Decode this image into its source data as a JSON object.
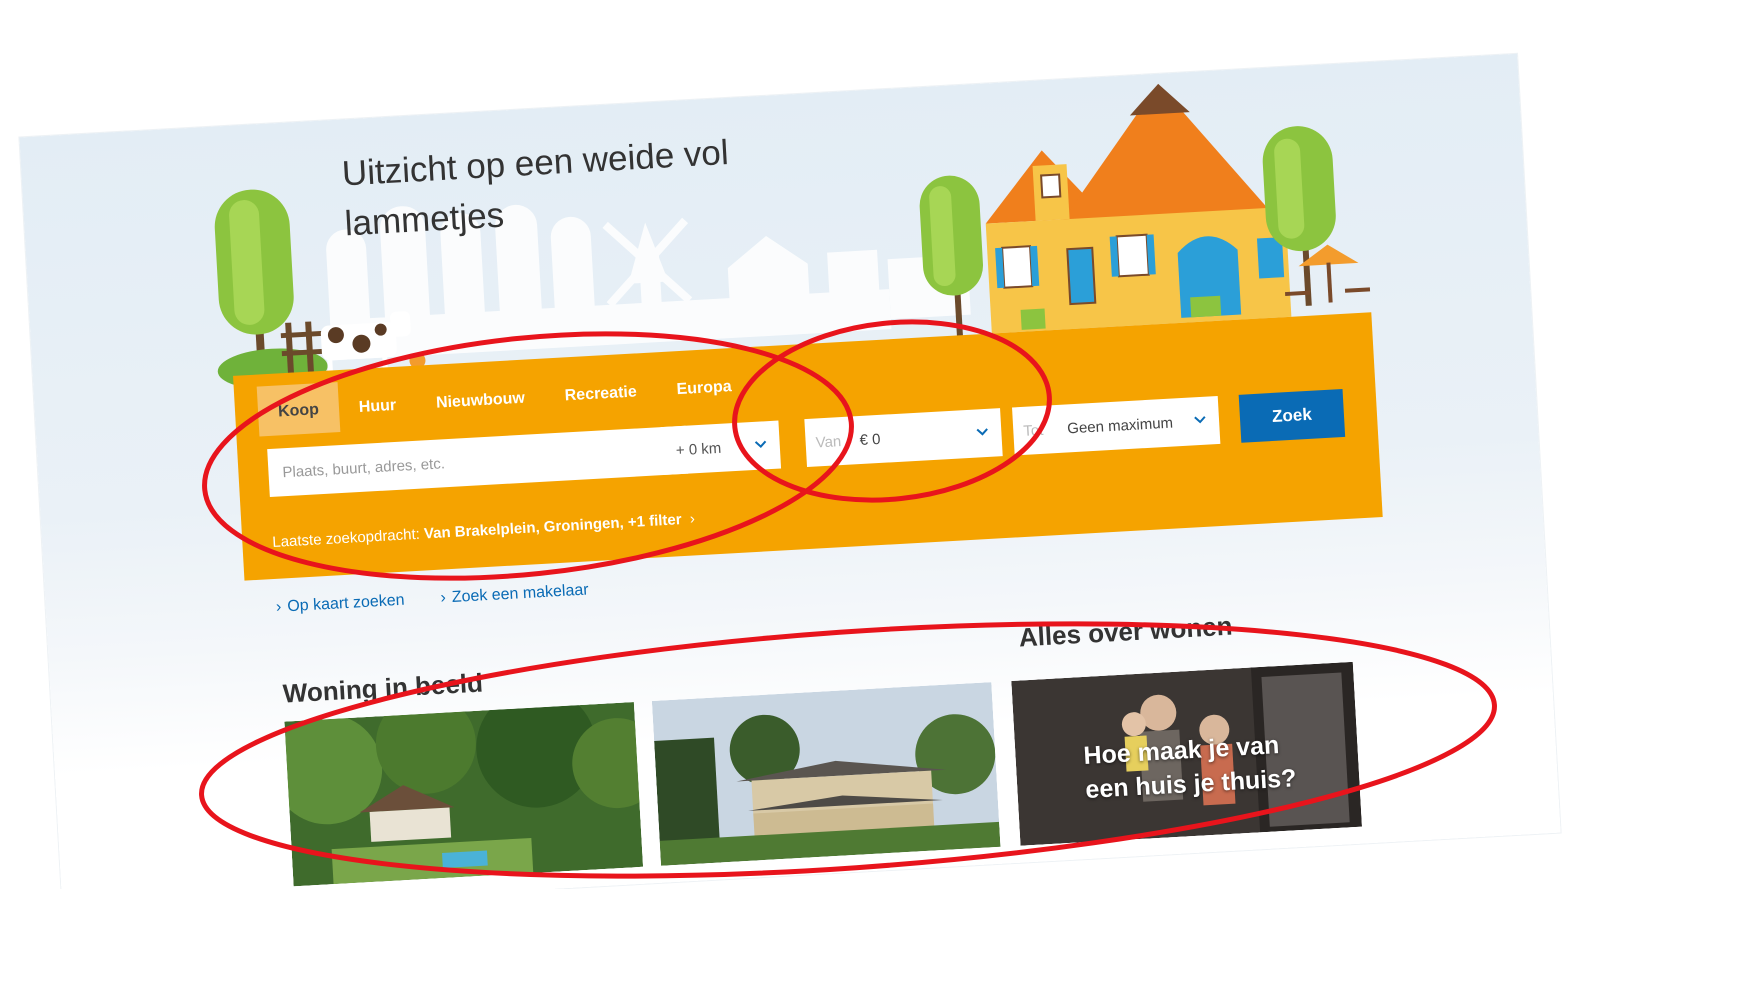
{
  "hero": {
    "title_line1": "Uitzicht op een weide vol",
    "title_line2": "lammetjes"
  },
  "search": {
    "tabs": [
      {
        "label": "Koop",
        "active": true
      },
      {
        "label": "Huur",
        "active": false
      },
      {
        "label": "Nieuwbouw",
        "active": false
      },
      {
        "label": "Recreatie",
        "active": false
      },
      {
        "label": "Europa",
        "active": false
      }
    ],
    "location_placeholder": "Plaats, buurt, adres, etc.",
    "radius_value": "+ 0 km",
    "price_from_label": "Van",
    "price_from_value": "€ 0",
    "price_to_label": "Tot",
    "price_to_value": "Geen maximum",
    "submit_label": "Zoek",
    "last_search_label": "Laatste zoekopdracht:",
    "last_search_value": "Van Brakelplein, Groningen, +1 filter"
  },
  "links": {
    "map_search": "Op kaart zoeken",
    "find_agent": "Zoek een makelaar"
  },
  "sections": {
    "woning_title": "Woning in beeld",
    "wonen_title": "Alles over wonen",
    "wonen_card_caption_line1": "Hoe maak je van",
    "wonen_card_caption_line2": "een huis je thuis?"
  },
  "colors": {
    "search_panel": "#f5a300",
    "active_tab": "#f7c165",
    "button": "#0a6bb5",
    "link": "#0a6bb5",
    "annotation": "#e8141c"
  },
  "icons": [
    "chevron-down-icon",
    "chevron-right-icon"
  ]
}
